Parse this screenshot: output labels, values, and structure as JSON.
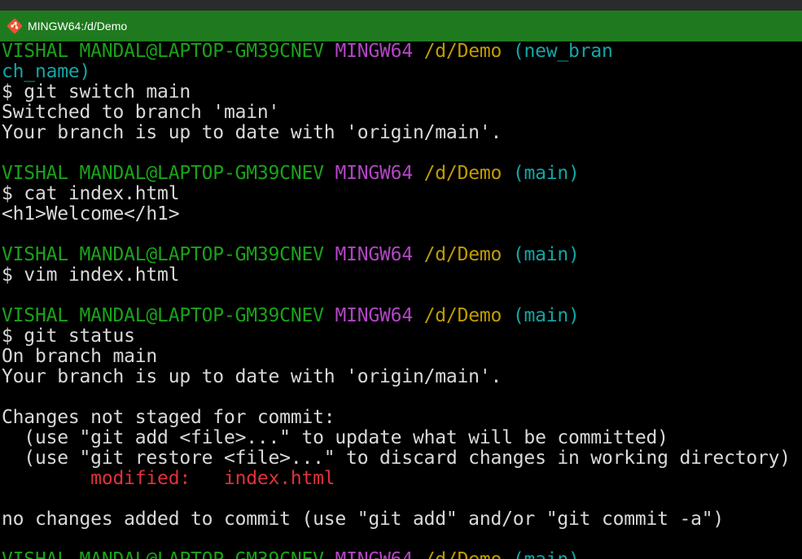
{
  "window": {
    "title": "MINGW64:/d/Demo",
    "icon": "git-bash-icon"
  },
  "colors": {
    "prompt_user": "#19a319",
    "prompt_system": "#b146c2",
    "prompt_path": "#c19c00",
    "prompt_branch": "#13a6a6",
    "modified": "#e0323a",
    "text": "#d9d9d9",
    "titlebar": "#1f7a1f"
  },
  "prompt": {
    "user_host": "VISHAL MANDAL@LAPTOP-GM39CNEV",
    "system": "MINGW64",
    "path": "/d/Demo"
  },
  "blocks": {
    "b1": {
      "branch_part1": "(new_bran",
      "branch_part2": "ch_name)",
      "command": "$ git switch main",
      "out1": "Switched to branch 'main'",
      "out2": "Your branch is up to date with 'origin/main'."
    },
    "b2": {
      "branch": "(main)",
      "command": "$ cat index.html",
      "out1": "<h1>Welcome</h1>"
    },
    "b3": {
      "branch": "(main)",
      "command": "$ vim index.html"
    },
    "b4": {
      "branch": "(main)",
      "command": "$ git status",
      "out1": "On branch main",
      "out2": "Your branch is up to date with 'origin/main'.",
      "out3": "Changes not staged for commit:",
      "out4": "  (use \"git add <file>...\" to update what will be committed)",
      "out5": "  (use \"git restore <file>...\" to discard changes in working directory)",
      "modified_label": "        modified:   ",
      "modified_file": "index.html",
      "out6": "no changes added to commit (use \"git add\" and/or \"git commit -a\")"
    },
    "b5": {
      "branch": "(main)"
    }
  }
}
